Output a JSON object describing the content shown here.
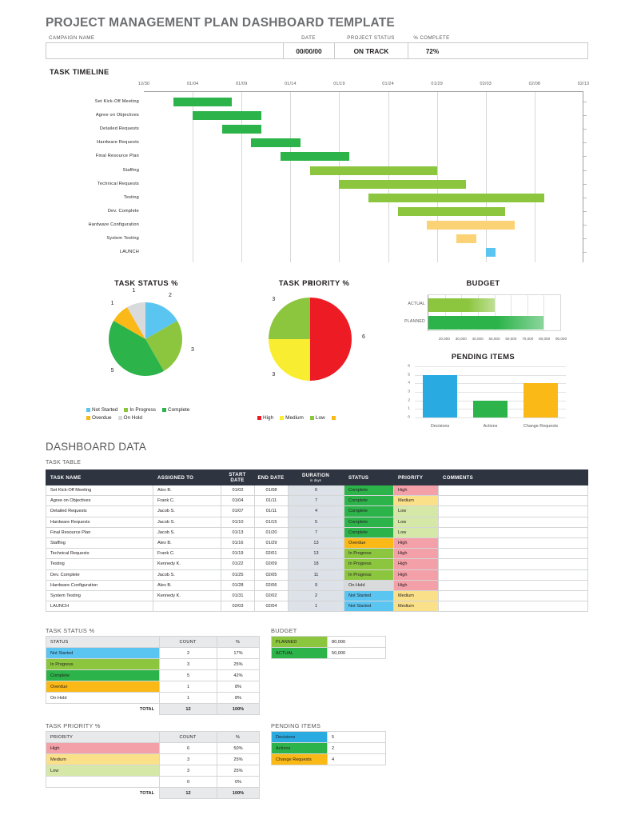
{
  "header": {
    "title": "PROJECT MANAGEMENT PLAN DASHBOARD TEMPLATE",
    "labels": {
      "campaign_name": "CAMPAIGN NAME",
      "date": "DATE",
      "project_status": "PROJECT STATUS",
      "percent_complete": "% COMPLETE"
    },
    "values": {
      "campaign_name": "",
      "date": "00/00/00",
      "project_status": "ON TRACK",
      "percent_complete": "72%"
    }
  },
  "sections": {
    "task_timeline": "TASK TIMELINE",
    "dashboard_data": "DASHBOARD DATA",
    "task_table": "TASK TABLE",
    "task_status_pct": "TASK STATUS %",
    "task_priority_pct": "TASK PRIORITY %",
    "budget": "BUDGET",
    "pending_items": "PENDING ITEMS"
  },
  "colors": {
    "complete": "#2cb34a",
    "in_progress": "#8cc63f",
    "not_started": "#5bc5f2",
    "overdue": "#fbb917",
    "on_hold": "#d9dadb",
    "high": "#ed1c24",
    "medium": "#f9ed32",
    "low": "#8cc63f",
    "high_cell": "#f4a0a8",
    "medium_cell": "#fbe08a",
    "low_cell": "#d6e8a8",
    "budget_planned": "#2cb34a",
    "budget_actual": "#8cc63f",
    "pending_decisions": "#29abe2",
    "pending_actions": "#2cb34a",
    "pending_change": "#fbb917",
    "header_dark": "#2e3440"
  },
  "chart_data": [
    {
      "type": "bar",
      "name": "task-timeline-gantt",
      "title": "TASK TIMELINE",
      "orientation": "horizontal",
      "grid": true,
      "xlabel": "",
      "ylabel": "",
      "x_ticks": [
        "12/30",
        "01/04",
        "01/09",
        "01/14",
        "01/19",
        "01/24",
        "01/29",
        "02/03",
        "02/08",
        "02/13"
      ],
      "axis_start": "12/30",
      "axis_end": "02/13",
      "categories": [
        "Set Kick-Off Meeting",
        "Agree on Objectives",
        "Detailed Requests",
        "Hardware Requests",
        "Final Resource Plan",
        "Staffing",
        "Technical Requests",
        "Testing",
        "Dev. Complete",
        "Hardware Configuration",
        "System Testing",
        "LAUNCH"
      ],
      "bars": [
        {
          "task": "Set Kick-Off Meeting",
          "start": "01/02",
          "end": "01/08",
          "duration": 6,
          "color": "#2cb34a"
        },
        {
          "task": "Agree on Objectives",
          "start": "01/04",
          "end": "01/11",
          "duration": 7,
          "color": "#2cb34a"
        },
        {
          "task": "Detailed Requests",
          "start": "01/07",
          "end": "01/11",
          "duration": 4,
          "color": "#2cb34a"
        },
        {
          "task": "Hardware Requests",
          "start": "01/10",
          "end": "01/15",
          "duration": 5,
          "color": "#2cb34a"
        },
        {
          "task": "Final Resource Plan",
          "start": "01/13",
          "end": "01/20",
          "duration": 7,
          "color": "#2cb34a"
        },
        {
          "task": "Staffing",
          "start": "01/16",
          "end": "01/29",
          "duration": 13,
          "color": "#8cc63f"
        },
        {
          "task": "Technical Requests",
          "start": "01/19",
          "end": "02/01",
          "duration": 13,
          "color": "#8cc63f"
        },
        {
          "task": "Testing",
          "start": "01/22",
          "end": "02/09",
          "duration": 18,
          "color": "#8cc63f"
        },
        {
          "task": "Dev. Complete",
          "start": "01/25",
          "end": "02/05",
          "duration": 11,
          "color": "#8cc63f"
        },
        {
          "task": "Hardware Configuration",
          "start": "01/28",
          "end": "02/06",
          "duration": 9,
          "color": "#fbd276"
        },
        {
          "task": "System Testing",
          "start": "01/31",
          "end": "02/02",
          "duration": 2,
          "color": "#fbd276"
        },
        {
          "task": "LAUNCH",
          "start": "02/03",
          "end": "02/04",
          "duration": 1,
          "color": "#5bc5f2"
        }
      ]
    },
    {
      "type": "pie",
      "name": "task-status-pie",
      "title": "TASK STATUS %",
      "labels": [
        "Not Started",
        "In Progress",
        "Complete",
        "Overdue",
        "On Hold"
      ],
      "values": [
        2,
        3,
        5,
        1,
        1
      ],
      "colors": [
        "#5bc5f2",
        "#8cc63f",
        "#2cb34a",
        "#fbb917",
        "#d9dadb"
      ],
      "legend_position": "bottom",
      "data_labels": [
        "2",
        "3",
        "5",
        "1",
        "1"
      ]
    },
    {
      "type": "pie",
      "name": "task-priority-pie",
      "title": "TASK PRIORITY %",
      "labels": [
        "High",
        "Medium",
        "Low",
        ""
      ],
      "values": [
        6,
        3,
        3,
        0
      ],
      "colors": [
        "#ed1c24",
        "#f9ed32",
        "#8cc63f",
        "#fbb917"
      ],
      "legend_position": "bottom",
      "data_labels": [
        "6",
        "3",
        "3",
        "0"
      ]
    },
    {
      "type": "bar",
      "name": "budget-bar",
      "title": "BUDGET",
      "orientation": "horizontal",
      "categories": [
        "ACTUAL",
        "PLANNED"
      ],
      "values": [
        50000,
        80000
      ],
      "colors": [
        "#8cc63f",
        "#2cb34a"
      ],
      "xlim": [
        10000,
        90000
      ],
      "x_ticks": [
        "20,000",
        "30,000",
        "40,000",
        "50,000",
        "60,000",
        "70,000",
        "80,000",
        "90,000"
      ],
      "grid": true
    },
    {
      "type": "bar",
      "name": "pending-items-bar",
      "title": "PENDING ITEMS",
      "orientation": "vertical",
      "categories": [
        "Decisions",
        "Actions",
        "Change Requests"
      ],
      "values": [
        5,
        2,
        4
      ],
      "colors": [
        "#29abe2",
        "#2cb34a",
        "#fbb917"
      ],
      "ylim": [
        0,
        6
      ],
      "y_ticks": [
        "0",
        "1",
        "2",
        "3",
        "4",
        "5",
        "6"
      ],
      "grid": true
    }
  ],
  "task_table": {
    "columns": [
      "TASK NAME",
      "ASSIGNED TO",
      "START DATE",
      "END DATE",
      "DURATION",
      "STATUS",
      "PRIORITY",
      "COMMENTS"
    ],
    "duration_sub": "in days",
    "rows": [
      {
        "name": "Set Kick-Off Meeting",
        "assigned": "Alex B.",
        "start": "01/02",
        "end": "01/08",
        "duration": "6",
        "status": "Complete",
        "priority": "High",
        "comments": ""
      },
      {
        "name": "Agree on Objectives",
        "assigned": "Frank C.",
        "start": "01/04",
        "end": "01/11",
        "duration": "7",
        "status": "Complete",
        "priority": "Medium",
        "comments": ""
      },
      {
        "name": "Detailed Requests",
        "assigned": "Jacob S.",
        "start": "01/07",
        "end": "01/11",
        "duration": "4",
        "status": "Complete",
        "priority": "Low",
        "comments": ""
      },
      {
        "name": "Hardware Requests",
        "assigned": "Jacob S.",
        "start": "01/10",
        "end": "01/15",
        "duration": "5",
        "status": "Complete",
        "priority": "Low",
        "comments": ""
      },
      {
        "name": "Final Resource Plan",
        "assigned": "Jacob S.",
        "start": "01/13",
        "end": "01/20",
        "duration": "7",
        "status": "Complete",
        "priority": "Low",
        "comments": ""
      },
      {
        "name": "Staffing",
        "assigned": "Alex B.",
        "start": "01/16",
        "end": "01/29",
        "duration": "13",
        "status": "Overdue",
        "priority": "High",
        "comments": ""
      },
      {
        "name": "Technical Requests",
        "assigned": "Frank C.",
        "start": "01/19",
        "end": "02/01",
        "duration": "13",
        "status": "In Progress",
        "priority": "High",
        "comments": ""
      },
      {
        "name": "Testing",
        "assigned": "Kennedy K.",
        "start": "01/22",
        "end": "02/09",
        "duration": "18",
        "status": "In Progress",
        "priority": "High",
        "comments": ""
      },
      {
        "name": "Dev. Complete",
        "assigned": "Jacob S.",
        "start": "01/25",
        "end": "02/05",
        "duration": "11",
        "status": "In Progress",
        "priority": "High",
        "comments": ""
      },
      {
        "name": "Hardware Configuration",
        "assigned": "Alex B.",
        "start": "01/28",
        "end": "02/06",
        "duration": "9",
        "status": "On Hold",
        "priority": "High",
        "comments": ""
      },
      {
        "name": "System Testing",
        "assigned": "Kennedy K.",
        "start": "01/31",
        "end": "02/02",
        "duration": "2",
        "status": "Not Started",
        "priority": "Medium",
        "comments": ""
      },
      {
        "name": "LAUNCH",
        "assigned": "",
        "start": "02/03",
        "end": "02/04",
        "duration": "1",
        "status": "Not Started",
        "priority": "Medium",
        "comments": ""
      }
    ]
  },
  "status_summary": {
    "title": "TASK STATUS %",
    "columns": [
      "STATUS",
      "COUNT",
      "%"
    ],
    "rows": [
      {
        "label": "Not Started",
        "count": "2",
        "pct": "17%",
        "color": "#5bc5f2"
      },
      {
        "label": "In Progress",
        "count": "3",
        "pct": "25%",
        "color": "#8cc63f"
      },
      {
        "label": "Complete",
        "count": "5",
        "pct": "42%",
        "color": "#2cb34a"
      },
      {
        "label": "Overdue",
        "count": "1",
        "pct": "8%",
        "color": "#fbb917"
      },
      {
        "label": "On Hold",
        "count": "1",
        "pct": "8%",
        "color": "#ffffff"
      }
    ],
    "total_label": "TOTAL",
    "total_count": "12",
    "total_pct": "100%"
  },
  "priority_summary": {
    "title": "TASK PRIORITY %",
    "columns": [
      "PRIORITY",
      "COUNT",
      "%"
    ],
    "rows": [
      {
        "label": "High",
        "count": "6",
        "pct": "50%",
        "color": "#f4a0a8"
      },
      {
        "label": "Medium",
        "count": "3",
        "pct": "25%",
        "color": "#fbe08a"
      },
      {
        "label": "Low",
        "count": "3",
        "pct": "25%",
        "color": "#d6e8a8"
      },
      {
        "label": "",
        "count": "0",
        "pct": "0%",
        "color": "#ffffff"
      }
    ],
    "total_label": "TOTAL",
    "total_count": "12",
    "total_pct": "100%"
  },
  "budget_summary": {
    "title": "BUDGET",
    "rows": [
      {
        "label": "PLANNED",
        "value": "80,000",
        "color": "#8cc63f"
      },
      {
        "label": "ACTUAL",
        "value": "50,000",
        "color": "#2cb34a"
      }
    ]
  },
  "pending_summary": {
    "title": "PENDING ITEMS",
    "rows": [
      {
        "label": "Decisions",
        "value": "5",
        "color": "#29abe2"
      },
      {
        "label": "Actions",
        "value": "2",
        "color": "#2cb34a"
      },
      {
        "label": "Change Requests",
        "value": "4",
        "color": "#fbb917"
      }
    ]
  }
}
